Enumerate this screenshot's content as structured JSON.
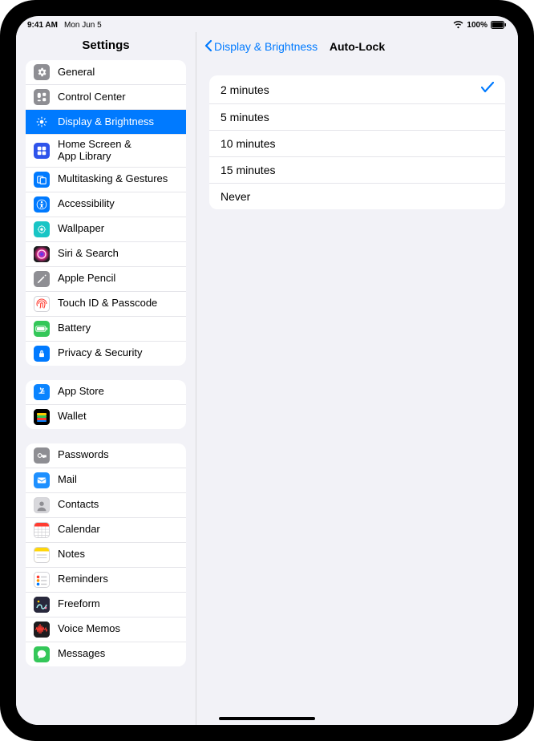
{
  "status": {
    "time": "9:41 AM",
    "date": "Mon Jun 5",
    "battery": "100%"
  },
  "sidebar": {
    "title": "Settings",
    "groups": [
      [
        {
          "icon": "general",
          "bg": "#8e8e93",
          "label": "General"
        },
        {
          "icon": "control-center",
          "bg": "#8e8e93",
          "label": "Control Center"
        },
        {
          "icon": "display",
          "bg": "#007aff",
          "label": "Display & Brightness",
          "selected": true
        },
        {
          "icon": "home",
          "bg": "#2f54eb",
          "label": "Home Screen &\nApp Library"
        },
        {
          "icon": "multitask",
          "bg": "#007aff",
          "label": "Multitasking & Gestures"
        },
        {
          "icon": "accessibility",
          "bg": "#007aff",
          "label": "Accessibility"
        },
        {
          "icon": "wallpaper",
          "bg": "#19c5c5",
          "label": "Wallpaper"
        },
        {
          "icon": "siri",
          "bg": "siri",
          "label": "Siri & Search"
        },
        {
          "icon": "pencil",
          "bg": "#8e8e93",
          "label": "Apple Pencil"
        },
        {
          "icon": "touchid",
          "bg": "#ffffff",
          "label": "Touch ID & Passcode"
        },
        {
          "icon": "battery",
          "bg": "#34c759",
          "label": "Battery"
        },
        {
          "icon": "privacy",
          "bg": "#007aff",
          "label": "Privacy & Security"
        }
      ],
      [
        {
          "icon": "appstore",
          "bg": "#0a84ff",
          "label": "App Store"
        },
        {
          "icon": "wallet",
          "bg": "#000000",
          "label": "Wallet"
        }
      ],
      [
        {
          "icon": "passwords",
          "bg": "#8e8e93",
          "label": "Passwords"
        },
        {
          "icon": "mail",
          "bg": "#1e90ff",
          "label": "Mail"
        },
        {
          "icon": "contacts",
          "bg": "#c7c7cc",
          "label": "Contacts"
        },
        {
          "icon": "calendar",
          "bg": "#ffffff",
          "label": "Calendar"
        },
        {
          "icon": "notes",
          "bg": "#ffe066",
          "label": "Notes"
        },
        {
          "icon": "reminders",
          "bg": "#ffffff",
          "label": "Reminders"
        },
        {
          "icon": "freeform",
          "bg": "#2b2b3a",
          "label": "Freeform"
        },
        {
          "icon": "voicememos",
          "bg": "#1c1c1e",
          "label": "Voice Memos"
        },
        {
          "icon": "messages",
          "bg": "#34c759",
          "label": "Messages"
        }
      ]
    ]
  },
  "nav": {
    "back": "Display & Brightness",
    "title": "Auto-Lock"
  },
  "options": [
    {
      "label": "2 minutes",
      "selected": true
    },
    {
      "label": "5 minutes",
      "selected": false
    },
    {
      "label": "10 minutes",
      "selected": false
    },
    {
      "label": "15 minutes",
      "selected": false
    },
    {
      "label": "Never",
      "selected": false
    }
  ]
}
